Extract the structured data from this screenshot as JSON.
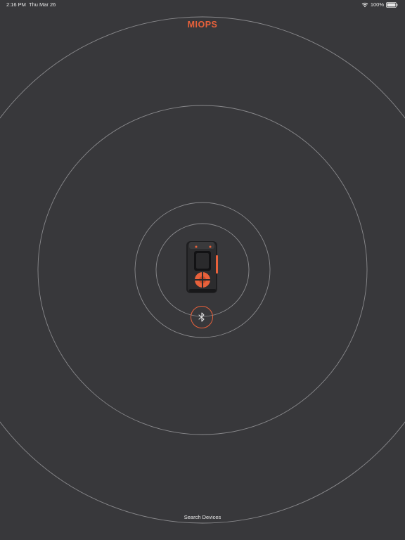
{
  "status_bar": {
    "time": "2:16 PM",
    "date": "Thu Mar 26",
    "battery": "100%",
    "icons": [
      "wifi-icon",
      "battery-icon"
    ]
  },
  "app": {
    "brand": "MIOPS"
  },
  "scan": {
    "bluetooth_icon": "bluetooth-icon",
    "search_label": "Search Devices"
  },
  "colors": {
    "background": "#38383b",
    "accent": "#e8613b",
    "ring": "#8a8a8d",
    "text": "#ececec"
  }
}
